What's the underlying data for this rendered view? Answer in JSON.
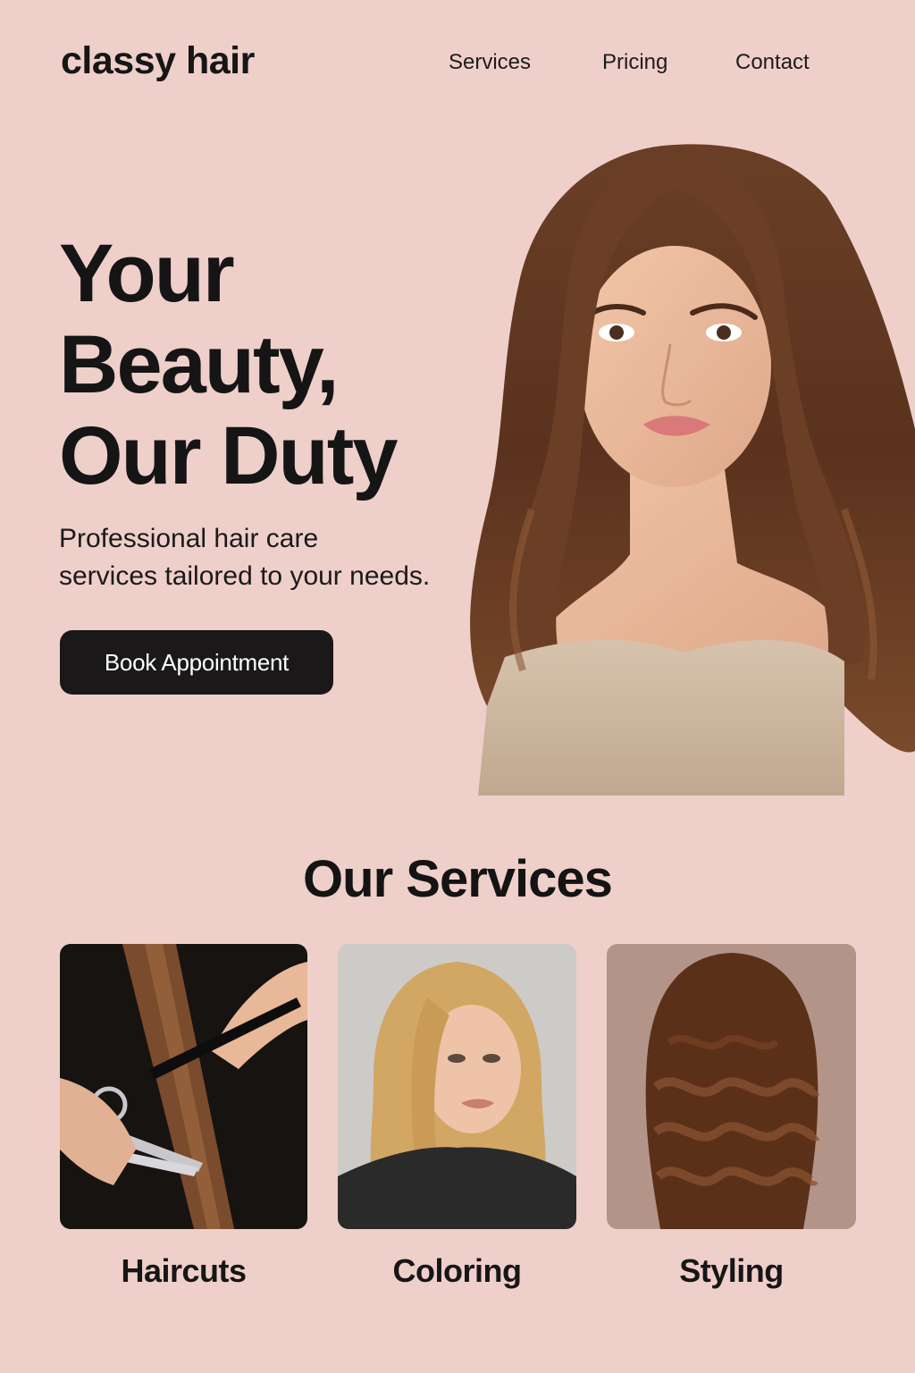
{
  "brand": {
    "name": "classy hair"
  },
  "nav": {
    "items": [
      {
        "label": "Services"
      },
      {
        "label": "Pricing"
      },
      {
        "label": "Contact"
      }
    ]
  },
  "hero": {
    "title_lines": [
      "Your",
      "Beauty,",
      "Our Duty"
    ],
    "subtitle_lines": [
      "Professional hair care",
      "services tailored to your needs."
    ],
    "cta_label": "Book Appointment",
    "image": "woman-long-wavy-brown-hair-portrait"
  },
  "services": {
    "heading": "Our Services",
    "cards": [
      {
        "label": "Haircuts",
        "image": "scissors-cutting-hair-photo"
      },
      {
        "label": "Coloring",
        "image": "blonde-bob-haircut-photo"
      },
      {
        "label": "Styling",
        "image": "wavy-brown-hair-back-photo"
      }
    ]
  },
  "colors": {
    "background": "#efcfca",
    "text": "#141414",
    "button": "#1a1818",
    "button_text": "#ffffff"
  }
}
